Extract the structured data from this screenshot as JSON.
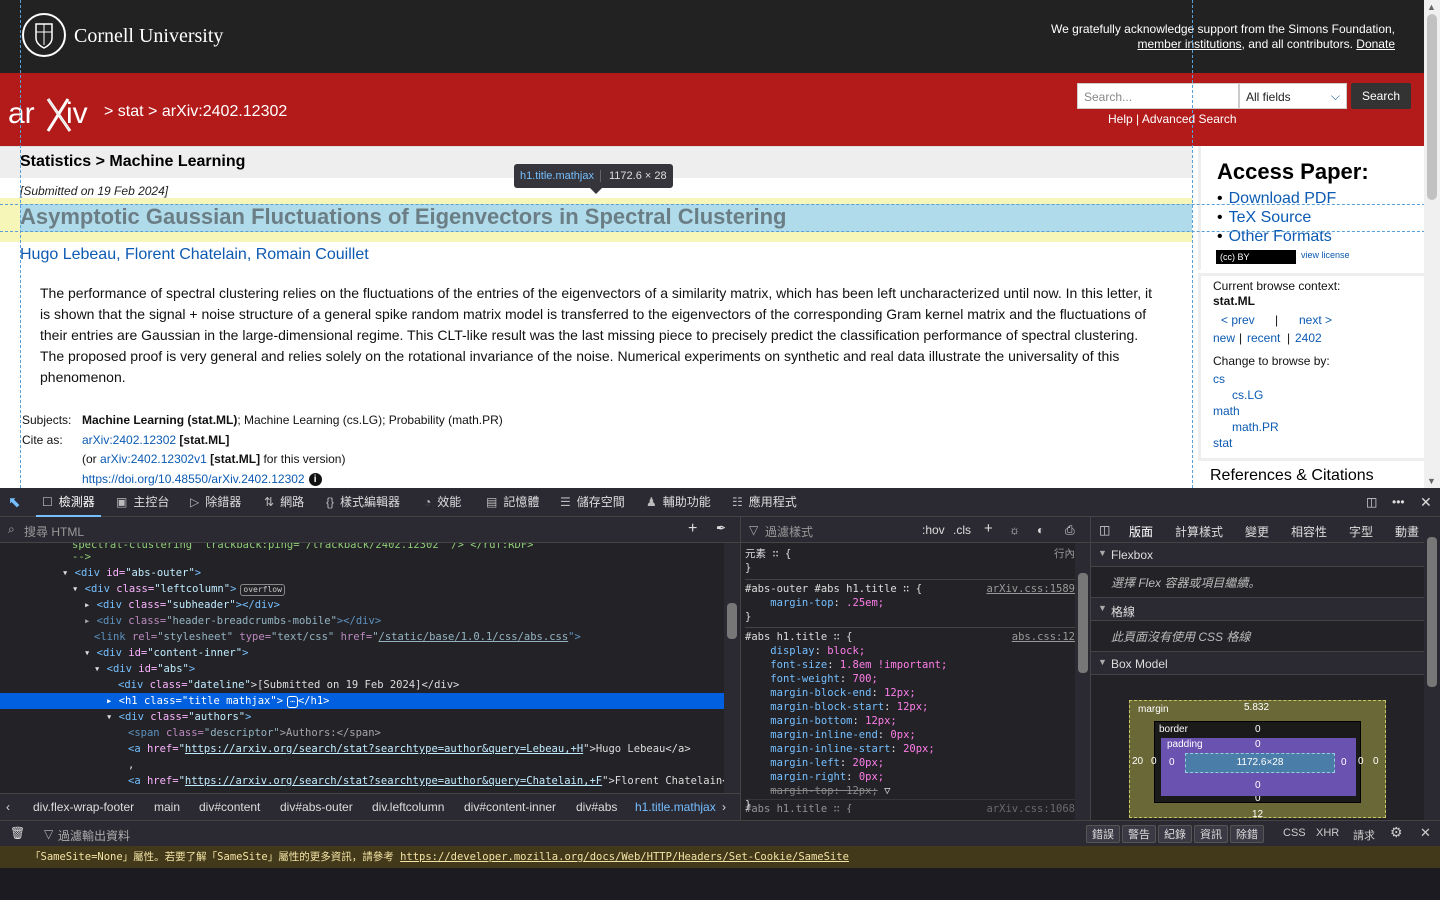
{
  "cornell": {
    "name": "Cornell University",
    "support_line1": "We gratefully acknowledge support from the Simons Foundation,",
    "support_link": "member institutions",
    "support_line2_mid": ", and all contributors.",
    "donate": "Donate"
  },
  "header": {
    "crumb_sep1": ">",
    "crumb_stat": "stat",
    "crumb_sep2": ">",
    "crumb_id": "arXiv:2402.12302",
    "search_placeholder": "Search...",
    "search_field": "All fields",
    "search_button": "Search",
    "help": "Help",
    "help_sep": "|",
    "advanced": "Advanced Search"
  },
  "paper": {
    "subheader": "Statistics > Machine Learning",
    "dateline": "[Submitted on 19 Feb 2024]",
    "title": "Asymptotic Gaussian Fluctuations of Eigenvectors in Spectral Clustering",
    "authors": [
      "Hugo Lebeau",
      "Florent Chatelain",
      "Romain Couillet"
    ],
    "abstract": "The performance of spectral clustering relies on the fluctuations of the entries of the eigenvectors of a similarity matrix, which has been left uncharacterized until now. In this letter, it is shown that the signal + noise structure of a general spike random matrix model is transferred to the eigenvectors of the corresponding Gram kernel matrix and the fluctuations of their entries are Gaussian in the large-dimensional regime. This CLT-like result was the last missing piece to precisely predict the classification performance of spectral clustering. The proposed proof is very general and relies solely on the rotational invariance of the noise. Numerical experiments on synthetic and real data illustrate the universality of this phenomenon.",
    "subjects_label": "Subjects:",
    "subjects_primary": "Machine Learning (stat.ML)",
    "subjects_rest": "; Machine Learning (cs.LG); Probability (math.PR)",
    "cite_label": "Cite as:",
    "cite_id": "arXiv:2402.12302",
    "cite_tag": "[stat.ML]",
    "cite_or": "(or",
    "cite_v1": "arXiv:2402.12302v1",
    "cite_tag2": "[stat.ML]",
    "cite_for": "for this version)",
    "doi": "https://doi.org/10.48550/arXiv.2402.12302",
    "info": "i"
  },
  "tooltip": {
    "selector": "h1.title.mathjax",
    "size": "1172.6 × 28"
  },
  "sidebar": {
    "access": "Access Paper:",
    "links": [
      "Download PDF",
      "TeX Source",
      "Other Formats"
    ],
    "cc": "(cc) BY",
    "view_license": "view license",
    "context_label": "Current browse context:",
    "context": "stat.ML",
    "prev": "< prev",
    "pipe": "|",
    "next": "next >",
    "new": "new",
    "recent": "recent",
    "month": "2402",
    "sep": "|",
    "change_label": "Change to browse by:",
    "browse": [
      "cs",
      "cs.LG",
      "math",
      "math.PR",
      "stat"
    ],
    "refs": "References & Citations"
  },
  "devtools": {
    "tabs": [
      "檢測器",
      "主控台",
      "除錯器",
      "網路",
      "樣式編輯器",
      "效能",
      "記憶體",
      "儲存空間",
      "輔助功能",
      "應用程式"
    ],
    "html_search": "搜尋 HTML",
    "tree": {
      "r0": "spectral-clustering\" trackback:ping=\"/trackback/2402.12302\" /> </rdf:RDF>",
      "r1": "-->",
      "r2_tag": "<div ",
      "r2_attr": "id=",
      "r2_val": "\"abs-outer\"",
      "r2_end": ">",
      "r3_tag": "<div ",
      "r3_attr": "class=",
      "r3_val": "\"leftcolumn\"",
      "r3_end": ">",
      "r3_badge": "overflow",
      "r4_tag": "<div ",
      "r4_attr": "class=",
      "r4_val": "\"subheader\"",
      "r4_end": "></div>",
      "r5_tag": "<div ",
      "r5_attr": "class=",
      "r5_val": "\"header-breadcrumbs-mobile\"",
      "r5_end": "></div>",
      "r6_tag": "<link ",
      "r6_attr": "rel=",
      "r6_val": "\"stylesheet\"",
      "r6_attr2": " type=",
      "r6_val2": "\"text/css\"",
      "r6_attr3": " href=",
      "r6_link": "/static/base/1.0.1/css/abs.css",
      "r6_end": "\">",
      "r7_tag": "<div ",
      "r7_attr": "id=",
      "r7_val": "\"content-inner\"",
      "r7_end": ">",
      "r8_tag": "<div ",
      "r8_attr": "id=",
      "r8_val": "\"abs\"",
      "r8_end": ">",
      "r9_tag": "<div ",
      "r9_attr": "class=",
      "r9_val": "\"dateline\"",
      "r9_text": ">[Submitted on 19 Feb 2024]</div>",
      "r10": "<h1 class=\"title mathjax\">",
      "r10_end": "</h1>",
      "r11_tag": "<div ",
      "r11_attr": "class=",
      "r11_val": "\"authors\"",
      "r11_end": ">",
      "r12_tag": "<span ",
      "r12_attr": "class=",
      "r12_val": "\"descriptor\"",
      "r12_text": ">Authors:</span>",
      "r13_tag": "<a ",
      "r13_attr": "href=",
      "r13_link": "https://arxiv.org/search/stat?searchtype=author&query=Lebeau,+H",
      "r13_text": "\">Hugo Lebeau</a>",
      "r14": ",",
      "r15_tag": "<a ",
      "r15_attr": "href=",
      "r15_link": "https://arxiv.org/search/stat?searchtype=author&query=Chatelain,+F",
      "r15_text": "\">Florent Chatelain</a>"
    },
    "breadcrumbs": [
      "div.flex-wrap-footer",
      "main",
      "div#content",
      "div#abs-outer",
      "div.leftcolumn",
      "div#content-inner",
      "div#abs",
      "h1.title.mathjax"
    ],
    "styles_filter": "過濾樣式",
    "hov": ":hov",
    "cls": ".cls",
    "rules": {
      "elem": "元素",
      "elem_brace": "{",
      "inline": "行內",
      "close": "}",
      "r1_sel": "#abs-outer #abs h1.title",
      "r1_src": "arXiv.css:1589",
      "r1_p": "margin-top",
      "r1_v": ".25em;",
      "r2_sel": "#abs h1.title",
      "r2_src": "abs.css:12",
      "props": [
        [
          "display",
          "block;"
        ],
        [
          "font-size",
          "1.8em !important;"
        ],
        [
          "font-weight",
          "700;"
        ],
        [
          "margin-block-end",
          "12px;"
        ],
        [
          "margin-block-start",
          "12px;"
        ],
        [
          "margin-bottom",
          "12px;"
        ],
        [
          "margin-inline-end",
          "0px;"
        ],
        [
          "margin-inline-start",
          "20px;"
        ],
        [
          "margin-left",
          "20px;"
        ],
        [
          "margin-right",
          "0px;"
        ]
      ],
      "struck": "margin-top: 12px;",
      "r3_sel": "#abs h1.title",
      "r3_src": "arXiv.css:1068"
    },
    "right_tabs": [
      "版面",
      "計算樣式",
      "變更",
      "相容性",
      "字型",
      "動畫"
    ],
    "flexbox": "Flexbox",
    "flex_note": "選擇 Flex 容器或項目繼續。",
    "grid": "格線",
    "grid_note": "此頁面沒有使用 CSS 格線",
    "boxmodel": "Box Model",
    "bm": {
      "margin": "margin",
      "margin_top": "5.832",
      "border": "border",
      "padding": "padding",
      "content": "1172.6×28",
      "zero": "0",
      "left": "20",
      "bottom": "12"
    },
    "console_filter": "過濾輸出資料",
    "console_buttons": [
      "錯誤",
      "警告",
      "紀錄",
      "資訊",
      "除錯"
    ],
    "console_tags": [
      "CSS",
      "XHR",
      "請求"
    ],
    "warning_text": "「SameSite=None」屬性。若要了解「SameSite」屬性的更多資訊，請參考 ",
    "warning_link": "https://developer.mozilla.org/docs/Web/HTTP/Headers/Set-Cookie/SameSite"
  },
  "colors": {
    "arxiv_red": "#b31b1b",
    "link": "#0c5ab2",
    "devtools_bg": "#232327",
    "selection": "#0060df"
  }
}
